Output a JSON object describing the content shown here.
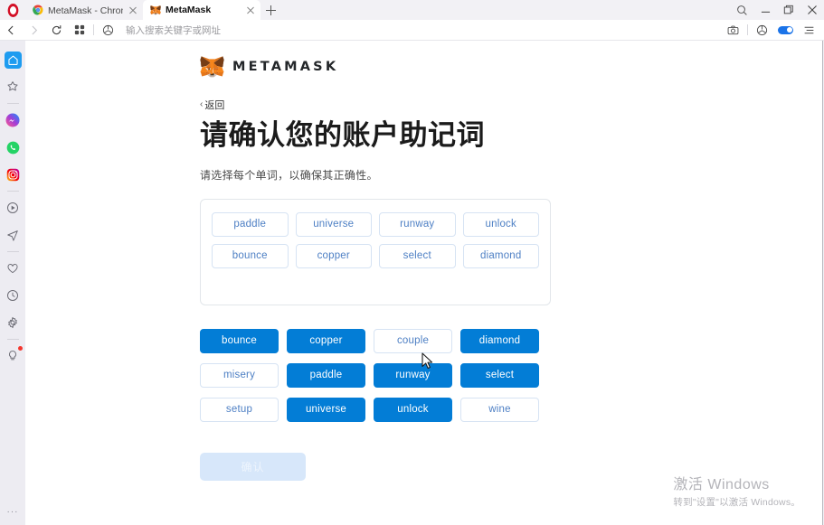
{
  "browser": {
    "name": "opera-browser",
    "tabs": [
      {
        "title": "MetaMask - Chrome 网上...",
        "favicon": "chrome-icon",
        "active": false
      },
      {
        "title": "MetaMask",
        "favicon": "metamask-fox-icon",
        "active": true
      }
    ],
    "newtab_label": "+",
    "window_controls": [
      "search-icon",
      "minimize-icon",
      "maximize-icon",
      "close-icon"
    ],
    "nav": {
      "back": "back-arrow-icon",
      "forward": "forward-arrow-icon",
      "reload": "reload-icon",
      "speeddial": "speed-dial-icon",
      "vpn_badge": "vpn-shield-icon"
    },
    "address": {
      "value": "",
      "placeholder": "输入搜索关键字或网址"
    },
    "toolbar_right": [
      "snapshot-camera-icon",
      "vpn-shield-icon",
      "vpn-toggle",
      "menu-icon"
    ],
    "sidebar_items": [
      {
        "name": "home",
        "icon": "home-icon",
        "active": true
      },
      {
        "name": "workspaces",
        "icon": "star-icon",
        "active": false
      },
      {
        "name": "divider-1",
        "icon": "divider",
        "active": false
      },
      {
        "name": "messenger",
        "icon": "messenger-icon",
        "active": false
      },
      {
        "name": "whatsapp",
        "icon": "whatsapp-icon",
        "active": false
      },
      {
        "name": "instagram",
        "icon": "instagram-icon",
        "active": false
      },
      {
        "name": "divider-2",
        "icon": "divider",
        "active": false
      },
      {
        "name": "player",
        "icon": "player-icon",
        "active": false
      },
      {
        "name": "telegram",
        "icon": "send-icon",
        "active": false
      },
      {
        "name": "divider-3",
        "icon": "divider",
        "active": false
      },
      {
        "name": "favorites",
        "icon": "heart-icon",
        "active": false
      },
      {
        "name": "history",
        "icon": "clock-icon",
        "active": false
      },
      {
        "name": "settings",
        "icon": "gear-icon",
        "active": false
      },
      {
        "name": "divider-4",
        "icon": "divider",
        "active": false
      },
      {
        "name": "tips",
        "icon": "lightbulb-icon",
        "active": false,
        "badge": true
      }
    ],
    "sidebar_more": "···"
  },
  "metamask": {
    "brand": "METAMASK",
    "logo_icon": "metamask-fox-icon",
    "back_label": "返回",
    "back_chevron": "‹",
    "title": "请确认您的账户助记词",
    "subtitle": "请选择每个单词，以确保其正确性。",
    "selected_words": [
      "paddle",
      "universe",
      "runway",
      "unlock",
      "bounce",
      "copper",
      "select",
      "diamond"
    ],
    "word_bank": [
      {
        "label": "bounce",
        "selected": true
      },
      {
        "label": "copper",
        "selected": true
      },
      {
        "label": "couple",
        "selected": false
      },
      {
        "label": "diamond",
        "selected": true
      },
      {
        "label": "misery",
        "selected": false
      },
      {
        "label": "paddle",
        "selected": true
      },
      {
        "label": "runway",
        "selected": true
      },
      {
        "label": "select",
        "selected": true
      },
      {
        "label": "setup",
        "selected": false
      },
      {
        "label": "universe",
        "selected": true
      },
      {
        "label": "unlock",
        "selected": true
      },
      {
        "label": "wine",
        "selected": false
      }
    ],
    "confirm_label": "确认",
    "confirm_disabled": true,
    "colors": {
      "primary": "#037dd6",
      "chip_border": "#d6e3f3",
      "chip_text": "#4d7fc4",
      "disabled_button": "#d7e7fa"
    }
  },
  "watermark": {
    "line1": "激活 Windows",
    "line2": "转到\"设置\"以激活 Windows。"
  }
}
